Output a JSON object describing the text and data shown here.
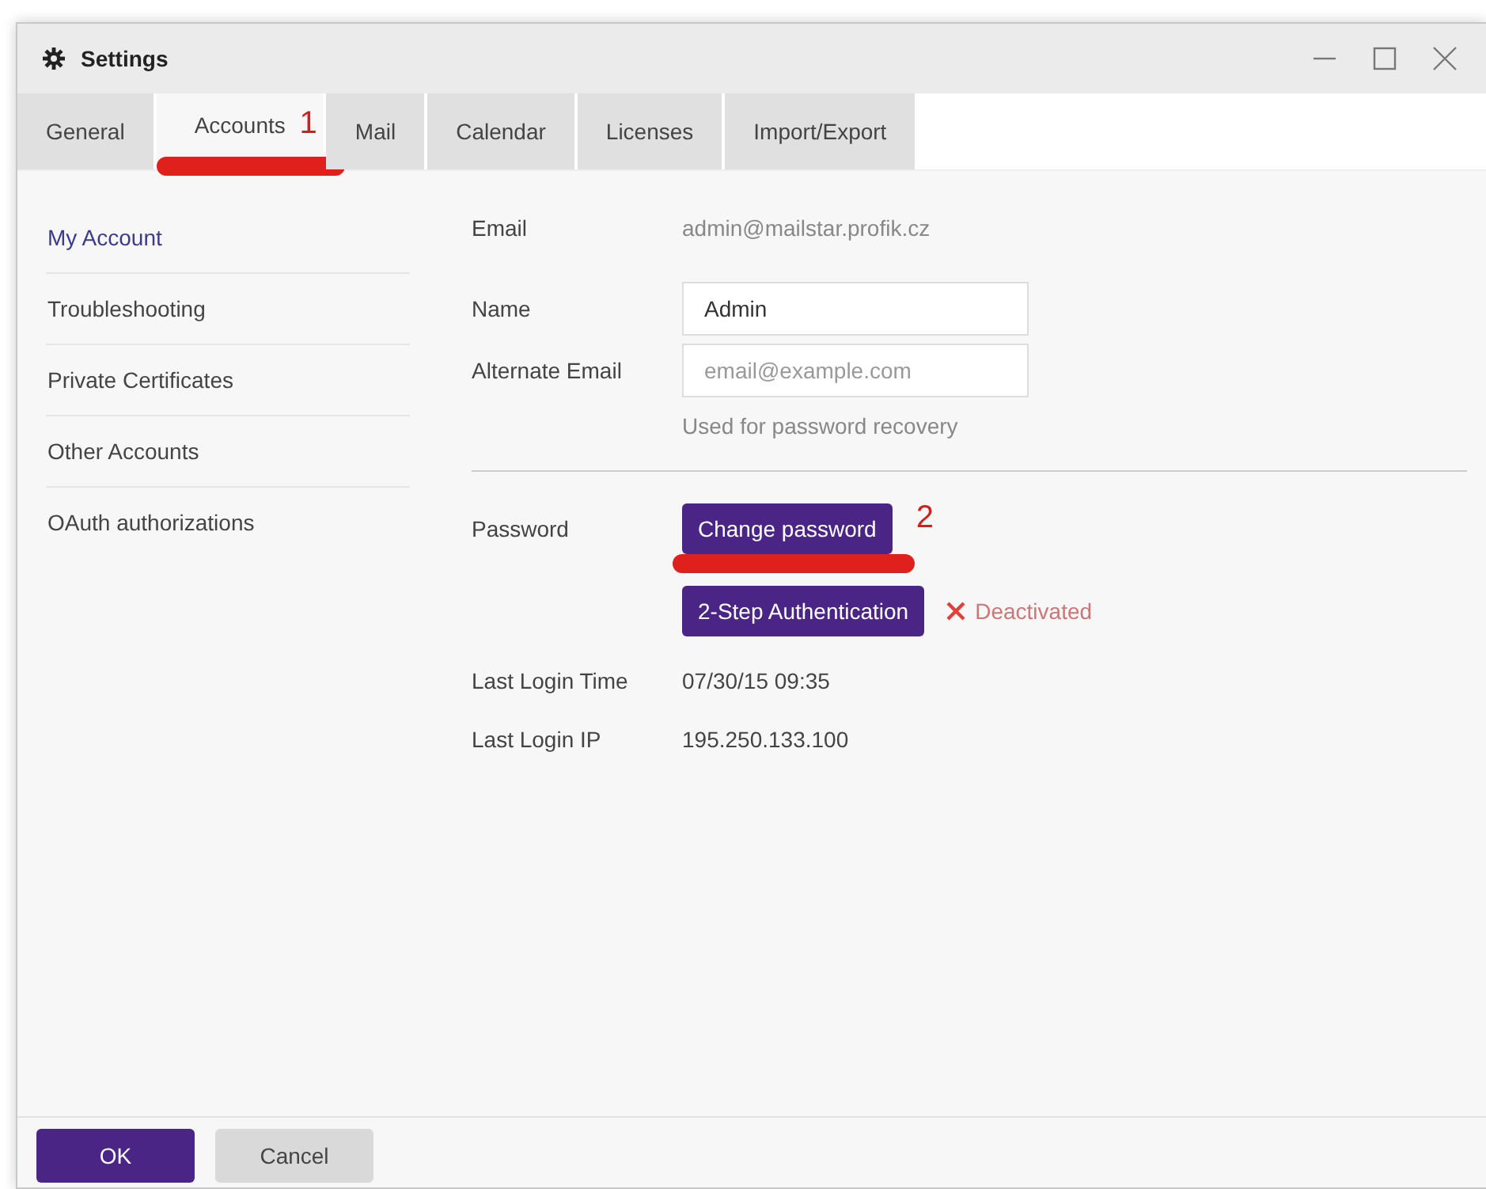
{
  "window": {
    "title": "Settings"
  },
  "tabs": [
    {
      "label": "General",
      "selected": false
    },
    {
      "label": "Accounts",
      "selected": true,
      "annotation": "1"
    },
    {
      "label": "Mail",
      "selected": false
    },
    {
      "label": "Calendar",
      "selected": false
    },
    {
      "label": "Licenses",
      "selected": false
    },
    {
      "label": "Import/Export",
      "selected": false
    }
  ],
  "sidebar": {
    "items": [
      {
        "label": "My Account",
        "selected": true
      },
      {
        "label": "Troubleshooting",
        "selected": false
      },
      {
        "label": "Private Certificates",
        "selected": false
      },
      {
        "label": "Other Accounts",
        "selected": false
      },
      {
        "label": "OAuth authorizations",
        "selected": false
      }
    ]
  },
  "account": {
    "email_label": "Email",
    "email": "admin@mailstar.profik.cz",
    "name_label": "Name",
    "name_value": "Admin",
    "alt_email_label": "Alternate Email",
    "alt_email_placeholder": "email@example.com",
    "alt_email_hint": "Used for password recovery",
    "password_label": "Password",
    "change_password": "Change password",
    "change_password_annotation": "2",
    "two_step": {
      "label": "2-Step Authentication",
      "status": "Deactivated",
      "active": false
    },
    "last_login_time_label": "Last Login Time",
    "last_login_time": "07/30/15 09:35",
    "last_login_ip_label": "Last Login IP",
    "last_login_ip": "195.250.133.100"
  },
  "buttons": [
    {
      "label": "OK",
      "kind": "primary"
    },
    {
      "label": "Cancel",
      "kind": "secondary"
    }
  ]
}
